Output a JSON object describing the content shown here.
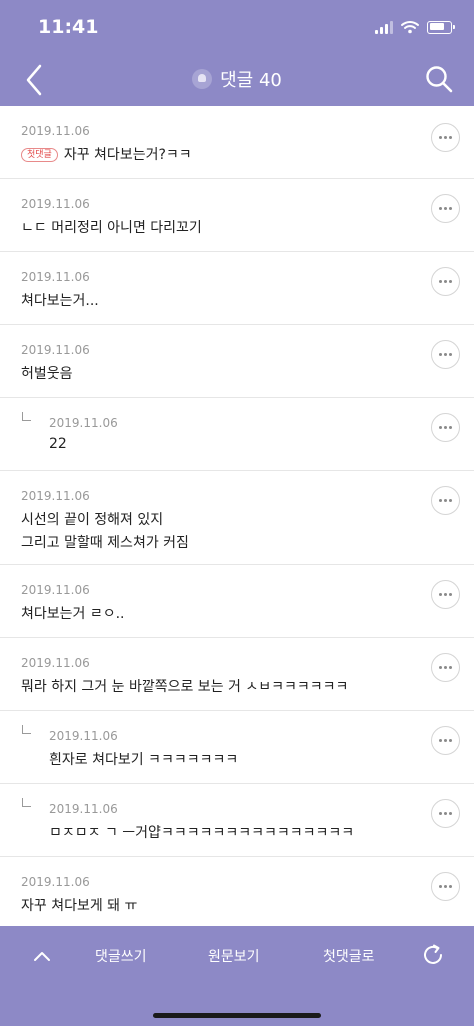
{
  "status_bar": {
    "time": "11:41"
  },
  "header": {
    "title": "댓글 40",
    "accent_color": "#8d89c6"
  },
  "badge_first": "첫댓글",
  "comments": [
    {
      "date": "2019.11.06",
      "lines": [
        "자꾸 쳐다보는거?ㅋㅋ"
      ],
      "reply": false,
      "first": true
    },
    {
      "date": "2019.11.06",
      "lines": [
        "ㄴㄷ 머리정리 아니면 다리꼬기"
      ],
      "reply": false
    },
    {
      "date": "2019.11.06",
      "lines": [
        "쳐다보는거..."
      ],
      "reply": false
    },
    {
      "date": "2019.11.06",
      "lines": [
        "허벌웃음"
      ],
      "reply": false
    },
    {
      "date": "2019.11.06",
      "lines": [
        "22"
      ],
      "reply": true
    },
    {
      "date": "2019.11.06",
      "lines": [
        "시선의 끝이 정해져 있지",
        "그리고 말할때 제스쳐가 커짐"
      ],
      "reply": false
    },
    {
      "date": "2019.11.06",
      "lines": [
        "쳐다보는거 ㄹㅇ.."
      ],
      "reply": false
    },
    {
      "date": "2019.11.06",
      "lines": [
        "뭐라 하지 그거 눈 바깥쪽으로 보는 거 ㅅㅂㅋㅋㅋㅋㅋㅋ"
      ],
      "reply": false
    },
    {
      "date": "2019.11.06",
      "lines": [
        "흰자로 쳐다보기 ㅋㅋㅋㅋㅋㅋㅋ"
      ],
      "reply": true
    },
    {
      "date": "2019.11.06",
      "lines": [
        "ㅁㅈㅁㅈ ㄱ ㅡ거얍ㅋㅋㅋㅋㅋㅋㅋㅋㅋㅋㅋㅋㅋㅋㅋ"
      ],
      "reply": true
    },
    {
      "date": "2019.11.06",
      "lines": [
        "자꾸 쳐다보게 돼 ㅠ"
      ],
      "reply": false
    }
  ],
  "bottom_bar": {
    "write": "댓글쓰기",
    "original": "원문보기",
    "first_comment": "첫댓글로"
  },
  "icons": {
    "back": "chevron-left-icon",
    "search": "search-icon",
    "more": "more-dots-icon",
    "up": "chevron-up-icon",
    "refresh": "refresh-icon"
  }
}
